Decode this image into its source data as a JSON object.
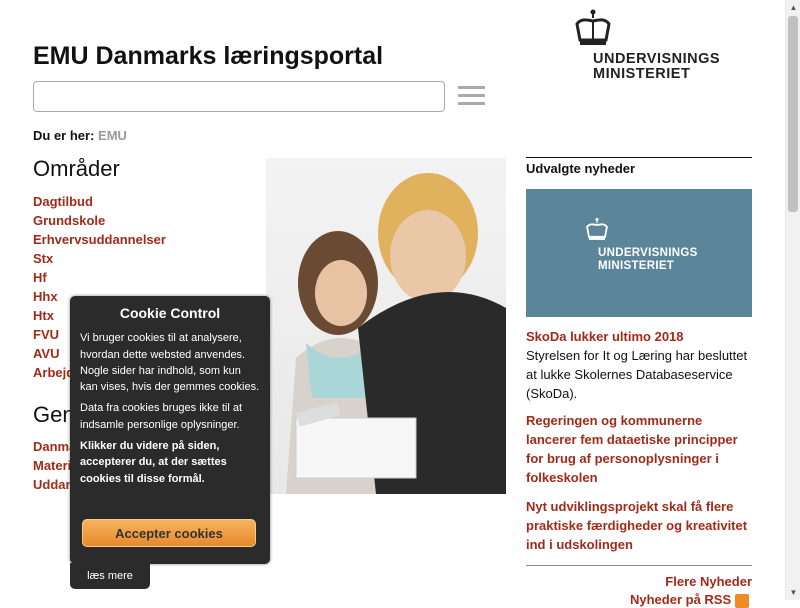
{
  "header": {
    "title": "EMU Danmarks læringsportal",
    "search_placeholder": "",
    "logo_line1": "UNDERVISNINGS",
    "logo_line2": "MINISTERIET"
  },
  "breadcrumb": {
    "label": "Du er her:",
    "current": "EMU"
  },
  "areas": {
    "heading": "Områder",
    "items": [
      "Dagtilbud",
      "Grundskole",
      "Erhvervsuddannelser",
      "Stx",
      "Hf",
      "Hhx",
      "Htx",
      "FVU",
      "AVU",
      "Arbejdsmarkedsuddannelser"
    ]
  },
  "shortcuts": {
    "heading": "Genveje",
    "items": [
      "Danmarks Læringsportal",
      "Materialeplatform",
      "Uddannelsesguiden"
    ]
  },
  "cookie": {
    "title": "Cookie Control",
    "text1": "Vi bruger cookies til at analysere, hvordan dette websted anvendes. Nogle sider har indhold, som kun kan vises, hvis der gemmes cookies.",
    "text2": "Data fra cookies bruges ikke til at indsamle personlige oplysninger.",
    "text3": "Klikker du videre på siden, accepterer du, at der sættes cookies til disse formål.",
    "accept_label": "Accepter cookies",
    "read_more_label": "læs mere"
  },
  "news": {
    "heading": "Udvalgte nyheder",
    "image_logo_line1": "UNDERVISNINGS",
    "image_logo_line2": "MINISTERIET",
    "items": [
      {
        "title": "SkoDa lukker ultimo 2018",
        "text": "Styrelsen for It og Læring har besluttet at lukke Skolernes Databaseservice (SkoDa)."
      },
      {
        "title": "Regeringen og kommunerne lancerer fem dataetiske principper for brug af personoplysninger i folkeskolen",
        "text": ""
      },
      {
        "title": "Nyt udviklingsprojekt skal få flere praktiske færdigheder og kreativitet ind i udskolingen",
        "text": ""
      }
    ],
    "more_label": "Flere Nyheder",
    "rss_label": "Nyheder på RSS"
  },
  "colors": {
    "link": "#a12b1b",
    "news_image_bg": "#5b8598",
    "cookie_bg": "#2b2b2b",
    "accept_btn": "#f0a040"
  }
}
